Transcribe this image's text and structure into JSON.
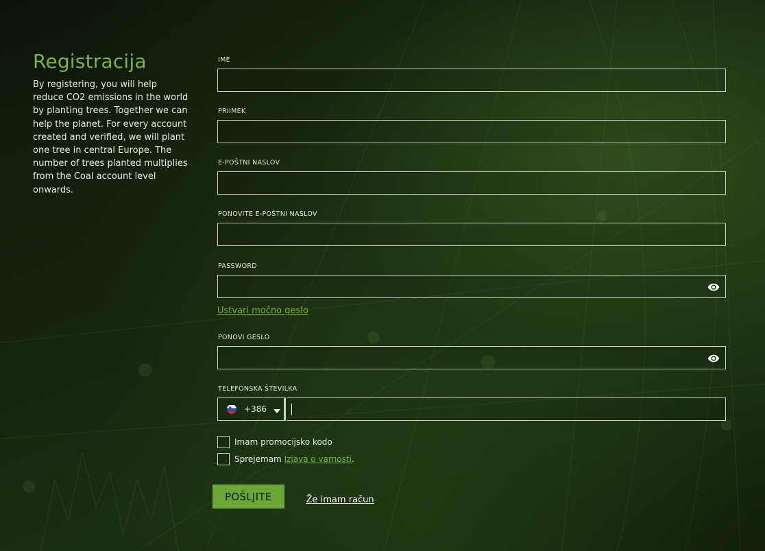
{
  "intro": {
    "title": "Registracija",
    "description": "By registering, you will help reduce CO2 emissions in the world by planting trees. Together we can help the planet. For every account created and verified, we will plant one tree in central Europe. The number of trees planted multiplies from the Coal account level onwards."
  },
  "form": {
    "first_name": {
      "label": "IME",
      "value": ""
    },
    "last_name": {
      "label": "PRIIMEK",
      "value": ""
    },
    "email": {
      "label": "E-POŠTNI NASLOV",
      "value": ""
    },
    "email_repeat": {
      "label": "PONOVITE E-POŠTNI NASLOV",
      "value": ""
    },
    "password": {
      "label": "PASSWORD",
      "value": ""
    },
    "strong_password_link": "Ustvari močno geslo",
    "password_repeat": {
      "label": "PONOVI GESLO",
      "value": ""
    },
    "phone": {
      "label": "TELEFONSKA ŠTEVILKA",
      "country_code": "+386",
      "value": ""
    },
    "promo_checkbox_label": "Imam promocijsko kodo",
    "privacy_prefix": "Sprejemam ",
    "privacy_link": "Izjava o varnosti",
    "privacy_suffix": ".",
    "submit_label": "POŠLJITE",
    "login_link": "Že imam račun"
  },
  "colors": {
    "accent": "#7cb53a",
    "button": "#6aa736"
  },
  "icons": {
    "password_toggle": "eye-icon",
    "country_flag": "slovenia-flag-icon",
    "dropdown": "caret-down-icon"
  }
}
